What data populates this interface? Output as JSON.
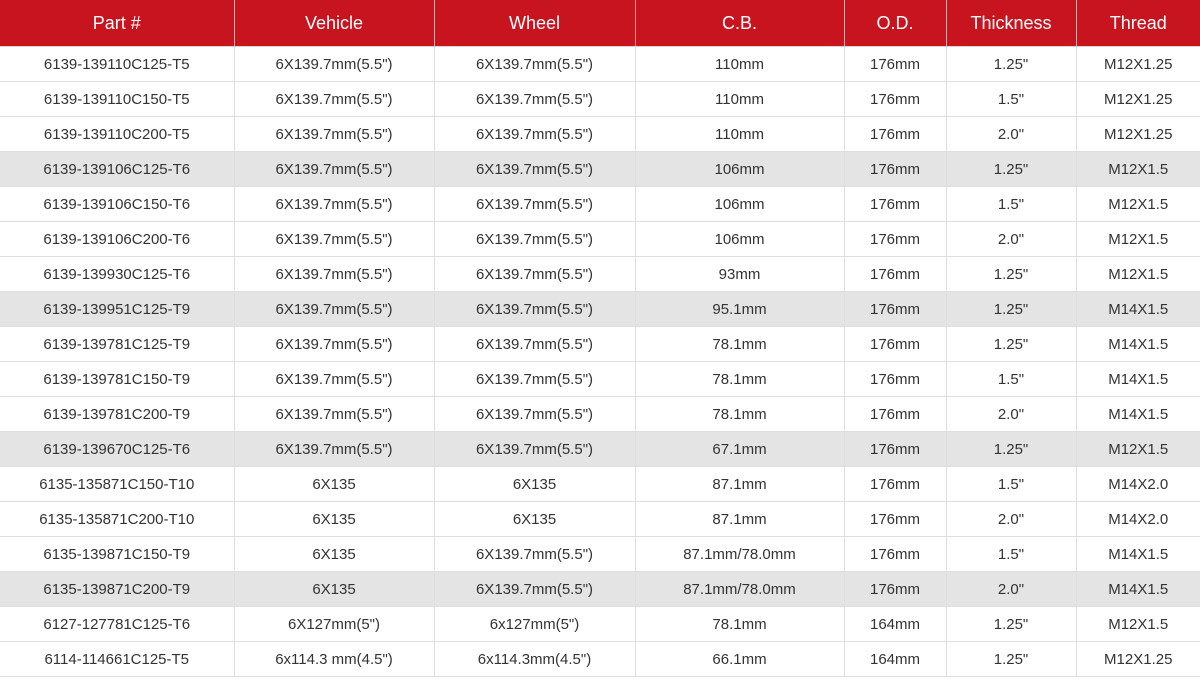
{
  "table": {
    "headers": [
      "Part #",
      "Vehicle",
      "Wheel",
      "C.B.",
      "O.D.",
      "Thickness",
      "Thread"
    ],
    "rows": [
      {
        "shaded": false,
        "cells": [
          "6139-139110C125-T5",
          "6X139.7mm(5.5\")",
          "6X139.7mm(5.5\")",
          "110mm",
          "176mm",
          "1.25\"",
          "M12X1.25"
        ]
      },
      {
        "shaded": false,
        "cells": [
          "6139-139110C150-T5",
          "6X139.7mm(5.5\")",
          "6X139.7mm(5.5\")",
          "110mm",
          "176mm",
          "1.5\"",
          "M12X1.25"
        ]
      },
      {
        "shaded": false,
        "cells": [
          "6139-139110C200-T5",
          "6X139.7mm(5.5\")",
          "6X139.7mm(5.5\")",
          "110mm",
          "176mm",
          "2.0\"",
          "M12X1.25"
        ]
      },
      {
        "shaded": true,
        "cells": [
          "6139-139106C125-T6",
          "6X139.7mm(5.5\")",
          "6X139.7mm(5.5\")",
          "106mm",
          "176mm",
          "1.25\"",
          "M12X1.5"
        ]
      },
      {
        "shaded": false,
        "cells": [
          "6139-139106C150-T6",
          "6X139.7mm(5.5\")",
          "6X139.7mm(5.5\")",
          "106mm",
          "176mm",
          "1.5\"",
          "M12X1.5"
        ]
      },
      {
        "shaded": false,
        "cells": [
          "6139-139106C200-T6",
          "6X139.7mm(5.5\")",
          "6X139.7mm(5.5\")",
          "106mm",
          "176mm",
          "2.0\"",
          "M12X1.5"
        ]
      },
      {
        "shaded": false,
        "cells": [
          "6139-139930C125-T6",
          "6X139.7mm(5.5\")",
          "6X139.7mm(5.5\")",
          "93mm",
          "176mm",
          "1.25\"",
          "M12X1.5"
        ]
      },
      {
        "shaded": true,
        "cells": [
          "6139-139951C125-T9",
          "6X139.7mm(5.5\")",
          "6X139.7mm(5.5\")",
          "95.1mm",
          "176mm",
          "1.25\"",
          "M14X1.5"
        ]
      },
      {
        "shaded": false,
        "cells": [
          "6139-139781C125-T9",
          "6X139.7mm(5.5\")",
          "6X139.7mm(5.5\")",
          "78.1mm",
          "176mm",
          "1.25\"",
          "M14X1.5"
        ]
      },
      {
        "shaded": false,
        "cells": [
          "6139-139781C150-T9",
          "6X139.7mm(5.5\")",
          "6X139.7mm(5.5\")",
          "78.1mm",
          "176mm",
          "1.5\"",
          "M14X1.5"
        ]
      },
      {
        "shaded": false,
        "cells": [
          "6139-139781C200-T9",
          "6X139.7mm(5.5\")",
          "6X139.7mm(5.5\")",
          "78.1mm",
          "176mm",
          "2.0\"",
          "M14X1.5"
        ]
      },
      {
        "shaded": true,
        "cells": [
          "6139-139670C125-T6",
          "6X139.7mm(5.5\")",
          "6X139.7mm(5.5\")",
          "67.1mm",
          "176mm",
          "1.25\"",
          "M12X1.5"
        ]
      },
      {
        "shaded": false,
        "cells": [
          "6135-135871C150-T10",
          "6X135",
          "6X135",
          "87.1mm",
          "176mm",
          "1.5\"",
          "M14X2.0"
        ]
      },
      {
        "shaded": false,
        "cells": [
          "6135-135871C200-T10",
          "6X135",
          "6X135",
          "87.1mm",
          "176mm",
          "2.0\"",
          "M14X2.0"
        ]
      },
      {
        "shaded": false,
        "cells": [
          "6135-139871C150-T9",
          "6X135",
          "6X139.7mm(5.5\")",
          "87.1mm/78.0mm",
          "176mm",
          "1.5\"",
          "M14X1.5"
        ]
      },
      {
        "shaded": true,
        "cells": [
          "6135-139871C200-T9",
          "6X135",
          "6X139.7mm(5.5\")",
          "87.1mm/78.0mm",
          "176mm",
          "2.0\"",
          "M14X1.5"
        ]
      },
      {
        "shaded": false,
        "cells": [
          "6127-127781C125-T6",
          "6X127mm(5\")",
          "6x127mm(5\")",
          "78.1mm",
          "164mm",
          "1.25\"",
          "M12X1.5"
        ]
      },
      {
        "shaded": false,
        "cells": [
          "6114-114661C125-T5",
          "6x114.3 mm(4.5\")",
          "6x114.3mm(4.5\")",
          "66.1mm",
          "164mm",
          "1.25\"",
          "M12X1.25"
        ]
      }
    ]
  },
  "colors": {
    "header_background": "#c8141f",
    "header_text": "#ffffff",
    "shaded_row": "#e4e4e4",
    "body_text": "#333333"
  }
}
